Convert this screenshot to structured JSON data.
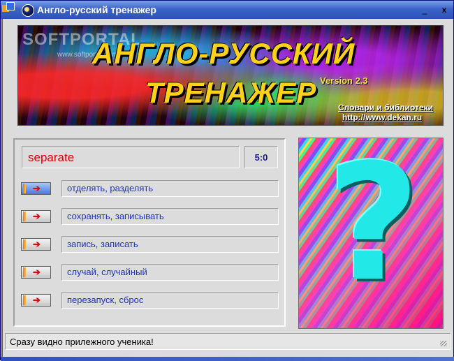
{
  "window": {
    "title": "Англо-русский тренажер",
    "minimize_label": "_",
    "close_label": "x"
  },
  "banner": {
    "watermark": "SOFTPORTAL",
    "watermark_url": "www.softportal.com",
    "title_line1": "АНГЛО-РУССКИЙ",
    "title_line2": "ТРЕНАЖЕР",
    "version": "Version 2.3",
    "link1": "Словари и библиотеки",
    "link2": "http://www.dekan.ru"
  },
  "quiz": {
    "word": "separate",
    "score": "5:0",
    "answers": [
      {
        "label": "отделять, разделять",
        "active": true
      },
      {
        "label": "сохранять, записывать",
        "active": false
      },
      {
        "label": "запись, записать",
        "active": false
      },
      {
        "label": "случай, случайный",
        "active": false
      },
      {
        "label": "перезапуск, сброс",
        "active": false
      }
    ],
    "arrow_glyph": "➔"
  },
  "picture": {
    "glyph": "?"
  },
  "status": {
    "text": "Сразу видно прилежного ученика!"
  },
  "colors": {
    "accent": "#2b52b8",
    "word": "#e00000",
    "answer_text": "#2030c0",
    "banner_text": "#ffd21a"
  }
}
